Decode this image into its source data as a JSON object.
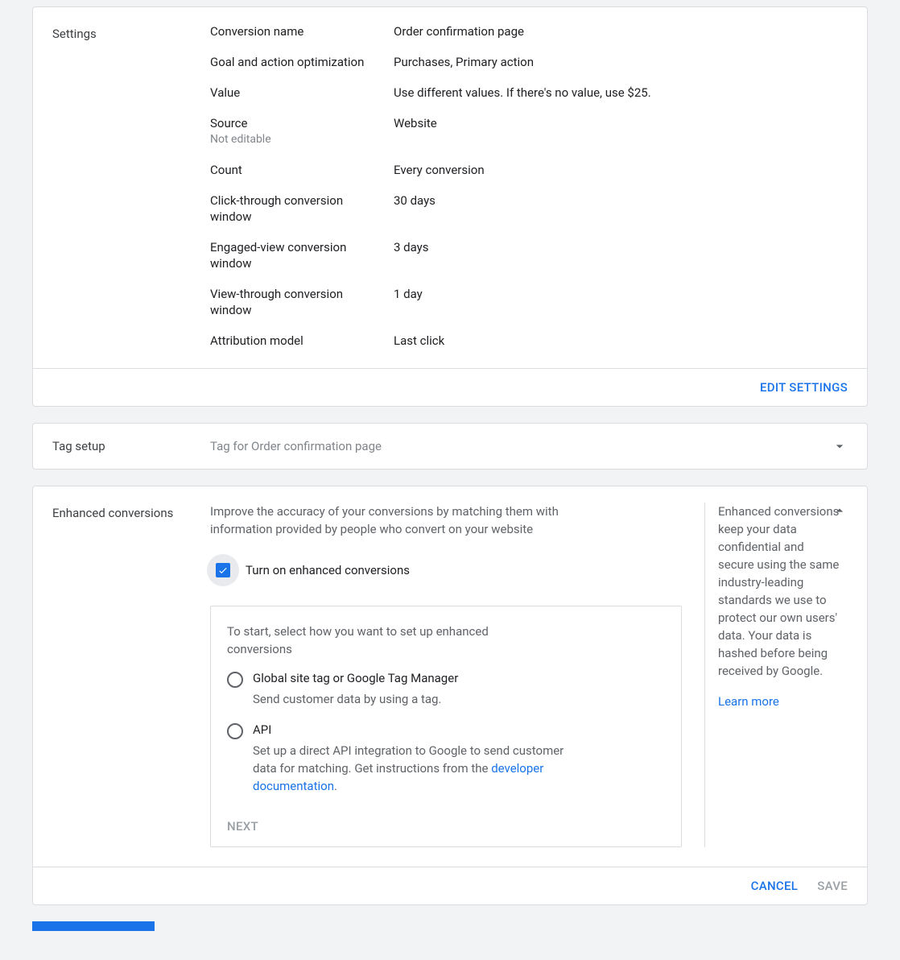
{
  "settings": {
    "section_label": "Settings",
    "rows": [
      {
        "label": "Conversion name",
        "value": "Order confirmation page"
      },
      {
        "label": "Goal and action optimization",
        "value": "Purchases, Primary action"
      },
      {
        "label": "Value",
        "value": "Use different values. If there's no value, use $25."
      },
      {
        "label": "Source",
        "sublabel": "Not editable",
        "value": "Website"
      },
      {
        "label": "Count",
        "value": "Every conversion"
      },
      {
        "label": "Click-through conversion window",
        "value": "30 days"
      },
      {
        "label": "Engaged-view conversion window",
        "value": "3 days"
      },
      {
        "label": "View-through conversion window",
        "value": "1 day"
      },
      {
        "label": "Attribution model",
        "value": "Last click"
      }
    ],
    "edit_button": "EDIT SETTINGS"
  },
  "tag_setup": {
    "label": "Tag setup",
    "value": "Tag for Order confirmation page"
  },
  "enhanced": {
    "section_label": "Enhanced conversions",
    "description": "Improve the accuracy of your conversions by matching them with information provided by people who convert on your website",
    "checkbox_label": "Turn on enhanced conversions",
    "setup_intro": "To start, select how you want to set up enhanced conversions",
    "options": [
      {
        "label": "Global site tag or Google Tag Manager",
        "desc": "Send customer data by using a tag."
      },
      {
        "label": "API",
        "desc_prefix": "Set up a direct API integration to Google to send customer data for matching. Get instructions from the ",
        "desc_link": "developer documentation",
        "desc_suffix": "."
      }
    ],
    "next_label": "NEXT",
    "side_text": "Enhanced conversions keep your data confidential and secure using the same industry-leading standards we use to protect our own users' data. Your data is hashed before being received by Google.",
    "side_link": "Learn more"
  },
  "footer": {
    "cancel": "CANCEL",
    "save": "SAVE"
  }
}
